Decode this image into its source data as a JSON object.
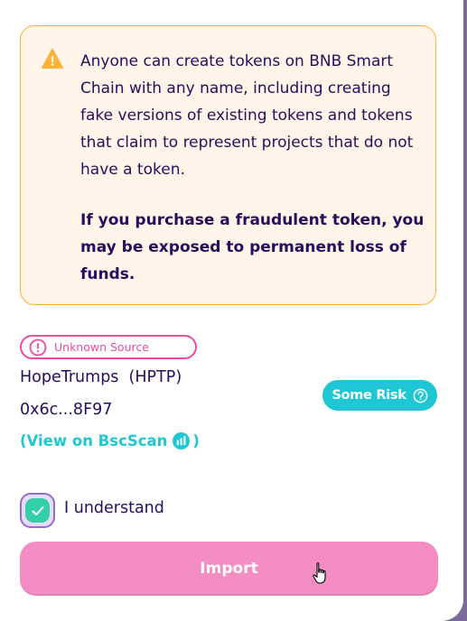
{
  "warning": {
    "text": "Anyone can create tokens on BNB Smart Chain with any name, including creating fake versions of existing tokens and tokens that claim to represent projects that do not have a token.",
    "bold_text": "If you purchase a fraudulent token, you may be exposed to permanent loss of funds."
  },
  "source": {
    "label": "Unknown Source"
  },
  "token": {
    "name": "HopeTrumps  (HPTP)",
    "address": "0x6c...8F97",
    "link_open": "(View on BscScan",
    "link_close": ")"
  },
  "risk": {
    "label": "Some Risk"
  },
  "acknowledge": {
    "label": "I understand",
    "checked": true
  },
  "import_button": {
    "label": "Import"
  },
  "colors": {
    "warning_bg": "#fff5e8",
    "warning_border": "#ffb237",
    "text": "#280d5f",
    "failure": "#ed4b9e",
    "primary": "#1fc7d4",
    "success": "#31d0aa",
    "button": "#f48dc3"
  },
  "icons": [
    "warning-icon",
    "error-circle-icon",
    "bscscan-icon",
    "help-icon",
    "check-icon",
    "hand-cursor-icon"
  ]
}
